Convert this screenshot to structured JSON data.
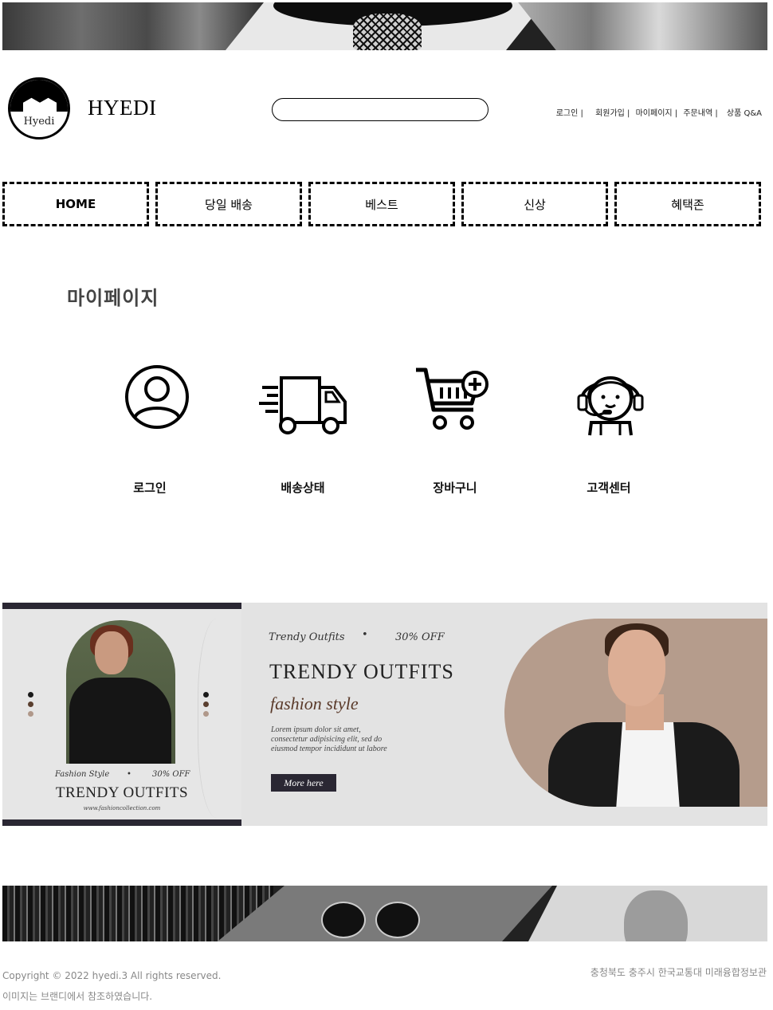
{
  "header": {
    "brand": "HYEDI",
    "logo_text": "Hyedi",
    "search_placeholder": "",
    "links": [
      "로그인 |",
      "회원가입 |",
      "마이페이지 |",
      "주문내역 |",
      "상품 Q&A"
    ]
  },
  "nav": {
    "items": [
      "HOME",
      "당일 배송",
      "베스트",
      "신상",
      "혜택존"
    ]
  },
  "mypage": {
    "title": "마이페이지",
    "menu": [
      {
        "label": "로그인",
        "icon": "user-icon"
      },
      {
        "label": "배송상태",
        "icon": "delivery-truck-icon"
      },
      {
        "label": "장바구니",
        "icon": "cart-add-icon"
      },
      {
        "label": "고객센터",
        "icon": "customer-service-icon"
      }
    ]
  },
  "banner": {
    "left": {
      "tag_left": "Fashion Style",
      "tag_dot": "•",
      "tag_right": "30% OFF",
      "title": "TRENDY OUTFITS",
      "url": "www.fashioncollection.com"
    },
    "mid": {
      "tag_left": "Trendy Outfits",
      "tag_dot": "•",
      "tag_right": "30% OFF",
      "title": "TRENDY OUTFITS",
      "subtitle": "fashion style",
      "lorem_1": "Lorem ipsum dolor sit amet,",
      "lorem_2": "consectetur adipisicing elit, sed do",
      "lorem_3": "eiusmod tempor incididunt ut labore",
      "button": "More here"
    },
    "colors": {
      "dark": "#2a2733",
      "accent": "#5a3a2a",
      "bg": "#e3e3e3"
    }
  },
  "footer": {
    "copyright": "Copyright © 2022 hyedi.3 All rights reserved.",
    "note": "이미지는 브랜디에서 참조하였습니다.",
    "address": "충청북도 충주시 한국교통대 미래융합정보관"
  }
}
